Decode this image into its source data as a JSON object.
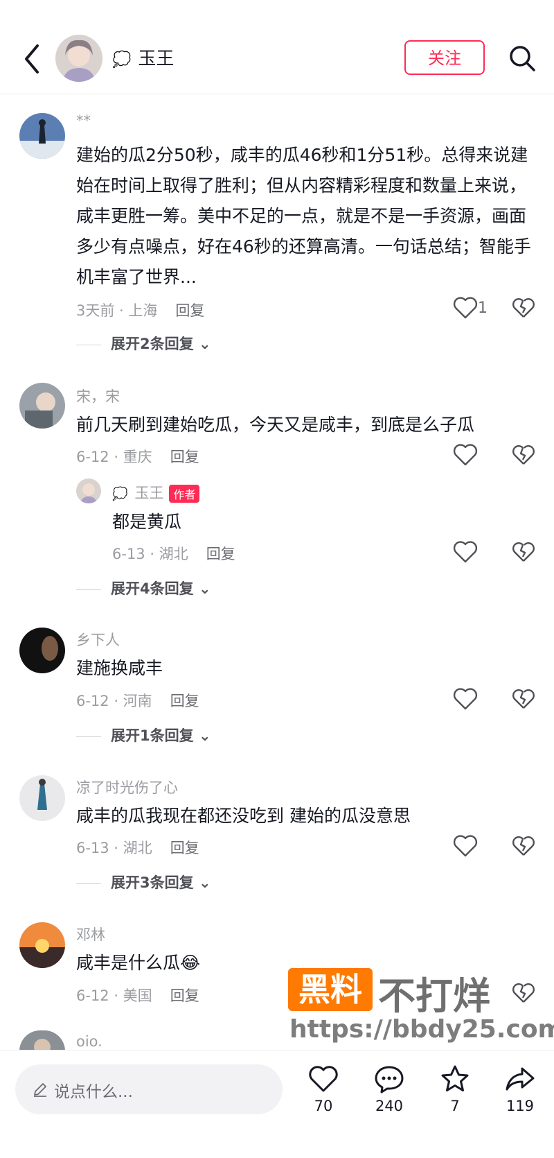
{
  "header": {
    "username": "玉王",
    "follow_label": "关注"
  },
  "comments": [
    {
      "name": "**",
      "text": "建始的瓜2分50秒，咸丰的瓜46秒和1分51秒。总得来说建始在时间上取得了胜利；但从内容精彩程度和数量上来说，咸丰更胜一筹。美中不足的一点，就是不是一手资源，画面多少有点噪点，好在46秒的还算高清。一句话总结；智能手机丰富了世界...",
      "meta": "3天前 · 上海",
      "reply": "回复",
      "likes": "1",
      "expand": "展开2条回复"
    },
    {
      "name": "宋，宋",
      "text": "前几天刷到建始吃瓜，今天又是咸丰，到底是么子瓜",
      "meta": "6-12 · 重庆",
      "reply": "回复",
      "sub": {
        "name": "玉王",
        "badge": "作者",
        "text": "都是黄瓜",
        "meta": "6-13 · 湖北",
        "reply": "回复"
      },
      "expand": "展开4条回复"
    },
    {
      "name": "乡下人",
      "text": "建施换咸丰",
      "meta": "6-12 · 河南",
      "reply": "回复",
      "expand": "展开1条回复"
    },
    {
      "name": "凉了时光伤了心",
      "text": "咸丰的瓜我现在都还没吃到 建始的瓜没意思",
      "meta": "6-13 · 湖北",
      "reply": "回复",
      "expand": "展开3条回复"
    },
    {
      "name": "邓林",
      "text": "咸丰是什么瓜😂",
      "meta": "6-12 · 美国",
      "reply": "回复"
    },
    {
      "name": "oio."
    }
  ],
  "watermark": {
    "box_text": "黑料",
    "brand": "不打烊",
    "url": "https://bbdy25.com"
  },
  "bottom_bar": {
    "placeholder": "说点什么...",
    "likes": "70",
    "comments": "240",
    "favorites": "7",
    "shares": "119"
  },
  "colors": {
    "accent": "#fe2c55",
    "watermark_orange": "#ff7a00"
  }
}
